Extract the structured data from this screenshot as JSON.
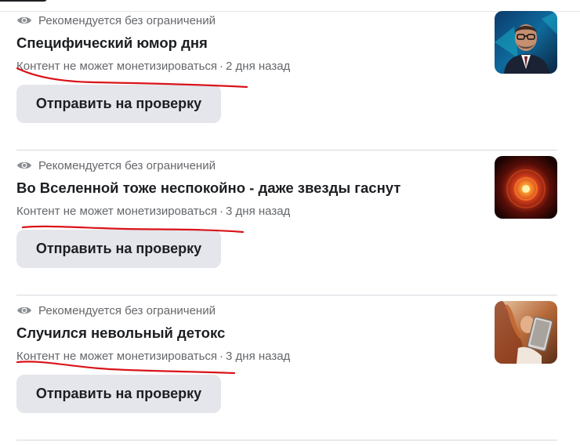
{
  "posts": [
    {
      "recommendation": "Рекомендуется без ограничений",
      "title": "Специфический юмор дня",
      "monetization": "Контент не может монетизироваться",
      "time": "2 дня назад",
      "button_label": "Отправить на проверку",
      "thumbnail": "man-in-glasses-tv-studio"
    },
    {
      "recommendation": "Рекомендуется без ограничений",
      "title": "Во Вселенной тоже неспокойно - даже звезды гаснут",
      "monetization": "Контент не может монетизироваться",
      "time": "3 дня назад",
      "button_label": "Отправить на проверку",
      "thumbnail": "glowing-orange-galaxy"
    },
    {
      "recommendation": "Рекомендуется без ограничений",
      "title": "Случился невольный детокс",
      "monetization": "Контент не может монетизироваться",
      "time": "3 дня назад",
      "button_label": "Отправить на проверку",
      "thumbnail": "person-with-tablet"
    }
  ],
  "separator": "·",
  "colors": {
    "text": "#1c1e21",
    "secondary": "#65676b",
    "button_bg": "#e4e6eb",
    "annotation_red": "#d9141a"
  }
}
